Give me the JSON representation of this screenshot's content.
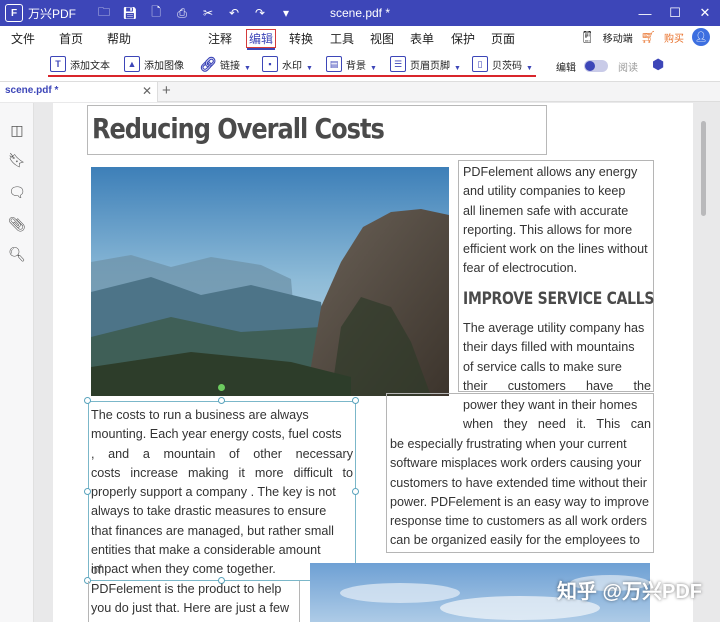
{
  "app": {
    "name": "万兴PDF",
    "logo_letter": "F"
  },
  "titlebar": {
    "doc_title": "scene.pdf *",
    "quick_icons": [
      "folder-icon",
      "save-icon",
      "file-icon",
      "print-icon",
      "scissors-icon",
      "undo-icon",
      "redo-icon",
      "dropdown-icon"
    ],
    "win_buttons": [
      "minimize-icon",
      "maximize-icon",
      "close-icon"
    ]
  },
  "menu": {
    "items": [
      "文件",
      "首页",
      "帮助",
      "注释",
      "编辑",
      "转换",
      "工具",
      "视图",
      "表单",
      "保护",
      "页面"
    ],
    "active": "编辑",
    "mobile": "移动端",
    "buy": "购买",
    "avatar_icon": "user-icon"
  },
  "ribbon": {
    "tools": [
      {
        "label": "添加文本",
        "icon": "text-icon"
      },
      {
        "label": "添加图像",
        "icon": "image-icon"
      },
      {
        "label": "链接",
        "icon": "link-icon"
      },
      {
        "label": "水印",
        "icon": "watermark-icon"
      },
      {
        "label": "背景",
        "icon": "background-icon"
      },
      {
        "label": "页眉页脚",
        "icon": "header-footer-icon"
      },
      {
        "label": "贝茨码",
        "icon": "bates-icon"
      }
    ],
    "mode_edit": "编辑",
    "mode_read": "阅读",
    "toggle_state": "edit"
  },
  "tabs": {
    "active": "scene.pdf *"
  },
  "sidebar_icons": [
    "thumbnails-icon",
    "bookmark-icon",
    "comment-icon",
    "attachment-icon",
    "search-icon"
  ],
  "document": {
    "heading": "Reducing Overall Costs",
    "right_col_1": [
      "PDFelement allows any energy",
      "and utility companies to keep",
      "all linemen safe with accurate",
      "reporting. This allows for more",
      "efficient work on the lines without",
      "fear of electrocution."
    ],
    "subheading": "IMPROVE SERVICE CALLS",
    "right_col_2": [
      "The average utility company has",
      "their days filled with mountains",
      "of service calls to make sure",
      "their customers have the",
      "power they want in their homes",
      "when they need it. This can"
    ],
    "wide_col": [
      "be especially frustrating when your current",
      "software misplaces work orders causing your",
      "customers to have extended time without their",
      "power. PDFelement is an easy way to improve",
      "response time to customers as all work orders",
      "can be organized easily for the employees to"
    ],
    "left_col": [
      "The costs to run a business are always",
      "mounting. Each year energy costs, fuel costs",
      ", and a mountain of other necessary",
      "costs increase making it more difficult to",
      "properly support a company . The key is not",
      "always to take drastic measures to ensure",
      "that finances are managed, but rather small",
      "entities that make a considerable amount",
      "impact when they come together."
    ],
    "overlap_word": "of",
    "left_col_2": [
      "PDFelement is the product to help",
      "you do just that. Here are just a few"
    ]
  },
  "watermark": "知乎 @万兴PDF",
  "colors": {
    "titlebar": "#3d46b8",
    "accent": "#3d46b8",
    "ribbon_underline": "#d9252b",
    "selection": "#7bb7c9"
  }
}
